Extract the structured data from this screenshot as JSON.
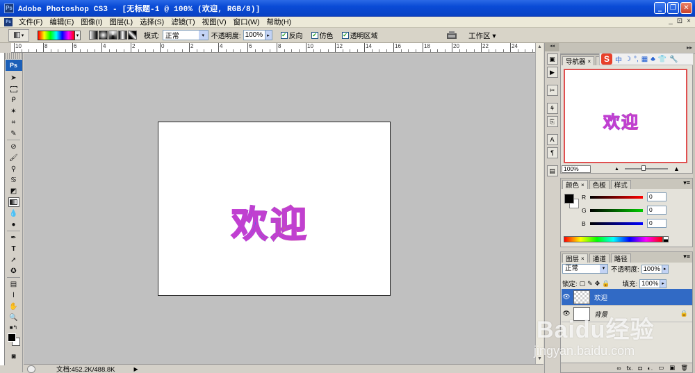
{
  "window": {
    "app_icon": "Ps",
    "title": "Adobe Photoshop CS3 - [无标题-1 @ 100% (欢迎, RGB/8)]",
    "controls": [
      "minimize-icon",
      "restore-icon",
      "close-icon"
    ]
  },
  "menu": {
    "items": [
      "文件(F)",
      "编辑(E)",
      "图像(I)",
      "图层(L)",
      "选择(S)",
      "滤镜(T)",
      "视图(V)",
      "窗口(W)",
      "帮助(H)"
    ],
    "doc_controls": [
      "_",
      "⊡",
      "×"
    ]
  },
  "options": {
    "mode_label": "模式:",
    "mode_value": "正常",
    "opacity_label": "不透明度:",
    "opacity_value": "100%",
    "reverse_label": "反向",
    "dither_label": "仿色",
    "transparency_label": "透明区域",
    "reverse_checked": true,
    "dither_checked": true,
    "transparency_checked": true,
    "workspace_label": "工作区 ▾"
  },
  "ruler": {
    "ticks": [
      "10",
      "8",
      "6",
      "4",
      "2",
      "0",
      "2",
      "4",
      "6",
      "8",
      "10",
      "12",
      "14",
      "16",
      "18",
      "20",
      "22",
      "24"
    ]
  },
  "toolbox": {
    "logo": "Ps"
  },
  "document": {
    "text": "欢迎"
  },
  "status": {
    "doc_info": "文档:452.2K/488.8K",
    "play": "▶"
  },
  "navigator": {
    "tabs": [
      "导航器",
      "直"
    ],
    "thumb_text": "欢迎",
    "zoom": "100%"
  },
  "ime": {
    "logo": "S",
    "items": [
      "中",
      "☽",
      "°,",
      "▦",
      "♣",
      "👕",
      "🔧"
    ]
  },
  "color": {
    "tabs": [
      "颜色",
      "色板",
      "样式"
    ],
    "r_label": "R",
    "g_label": "G",
    "b_label": "B",
    "r_value": "0",
    "g_value": "0",
    "b_value": "0"
  },
  "layers": {
    "tabs": [
      "图层",
      "通道",
      "路径"
    ],
    "blend_mode": "正常",
    "opacity_label": "不透明度:",
    "opacity_value": "100%",
    "lock_label": "锁定:",
    "fill_label": "填充:",
    "fill_value": "100%",
    "items": [
      {
        "name": "欢迎",
        "selected": true
      },
      {
        "name": "背景",
        "selected": false
      }
    ],
    "footer_icons": [
      "∞",
      "fx.",
      "◘",
      "◐.",
      "▭",
      "▣",
      "🗑"
    ]
  },
  "watermark": {
    "main": "Baidu经验",
    "sub": "jingyan.baidu.com"
  }
}
